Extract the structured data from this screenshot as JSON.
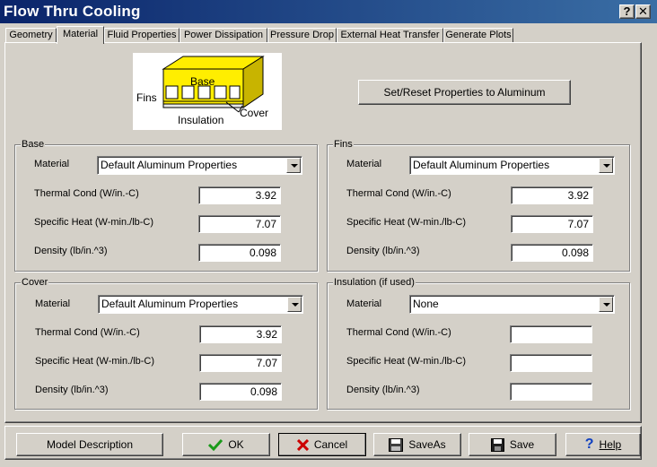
{
  "window": {
    "title": "Flow Thru Cooling",
    "help_glyph": "?",
    "close_glyph": "✕"
  },
  "tabs": [
    {
      "label": "Geometry",
      "active": false
    },
    {
      "label": "Material",
      "active": true
    },
    {
      "label": "Fluid Properties",
      "active": false
    },
    {
      "label": "Power Dissipation",
      "active": false
    },
    {
      "label": "Pressure Drop",
      "active": false
    },
    {
      "label": "External Heat Transfer",
      "active": false
    },
    {
      "label": "Generate Plots",
      "active": false
    }
  ],
  "diagram": {
    "base": "Base",
    "fins": "Fins",
    "insulation": "Insulation",
    "cover": "Cover"
  },
  "reset_button": "Set/Reset Properties to Aluminum",
  "groups": {
    "base": {
      "title": "Base",
      "material_label": "Material",
      "material": "Default Aluminum Properties",
      "thermal_label": "Thermal Cond (W/in.-C)",
      "thermal": "3.92",
      "specific_label": "Specific Heat (W-min./lb-C)",
      "specific": "7.07",
      "density_label": "Density (lb/in.^3)",
      "density": "0.098"
    },
    "fins": {
      "title": "Fins",
      "material_label": "Material",
      "material": "Default Aluminum Properties",
      "thermal_label": "Thermal Cond (W/in.-C)",
      "thermal": "3.92",
      "specific_label": "Specific Heat (W-min./lb-C)",
      "specific": "7.07",
      "density_label": "Density (lb/in.^3)",
      "density": "0.098"
    },
    "cover": {
      "title": "Cover",
      "material_label": "Material",
      "material": "Default Aluminum Properties",
      "thermal_label": "Thermal Cond (W/in.-C)",
      "thermal": "3.92",
      "specific_label": "Specific Heat (W-min./lb-C)",
      "specific": "7.07",
      "density_label": "Density (lb/in.^3)",
      "density": "0.098"
    },
    "insulation": {
      "title": "Insulation (if used)",
      "material_label": "Material",
      "material": "None",
      "thermal_label": "Thermal Cond (W/in.-C)",
      "thermal": "",
      "specific_label": "Specific Heat (W-min./lb-C)",
      "specific": "",
      "density_label": "Density (lb/in.^3)",
      "density": ""
    }
  },
  "footer": {
    "model_description": "Model Description",
    "ok": "OK",
    "cancel": "Cancel",
    "save_as": "SaveAs",
    "save": "Save",
    "help": "Help"
  },
  "colors": {
    "titlebar_start": "#0a246a",
    "titlebar_end": "#3a6ea5",
    "face": "#d4d0c8",
    "fin_yellow": "#ffee00",
    "ok_check": "#1a9a1a",
    "cancel_x": "#cc0000",
    "help_q": "#1040c0"
  }
}
